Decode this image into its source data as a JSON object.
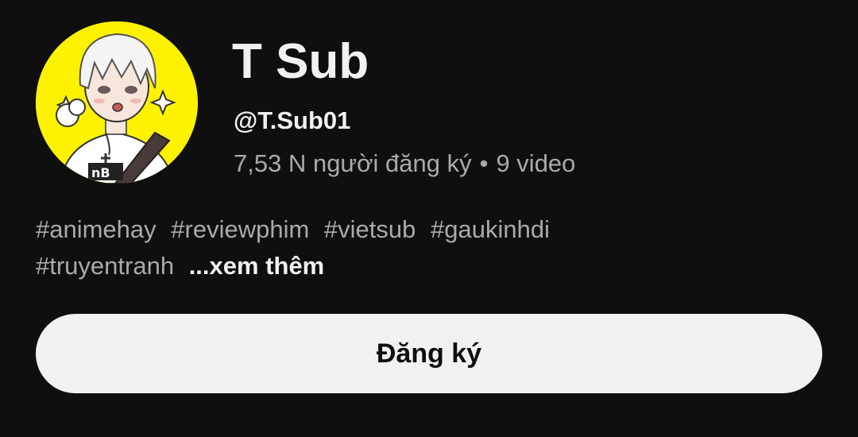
{
  "channel": {
    "name": "T Sub",
    "handle": "@T.Sub01",
    "subscribers": "7,53 N người đăng ký",
    "separator": "•",
    "video_count": "9 video",
    "avatar_icon": "anime-avatar-icon",
    "avatar_bg": "#fff200"
  },
  "description": {
    "line1_tags": [
      "#animehay",
      "#reviewphim",
      "#vietsub",
      "#gaukinhdi"
    ],
    "line2_tag": "#truyentranh",
    "more_label": "...xem thêm"
  },
  "subscribe": {
    "label": "Đăng ký"
  },
  "colors": {
    "background": "#0f0f0f",
    "primary_text": "#f1f1f1",
    "secondary_text": "#aaaaaa",
    "button_bg": "#f1f1f1"
  }
}
